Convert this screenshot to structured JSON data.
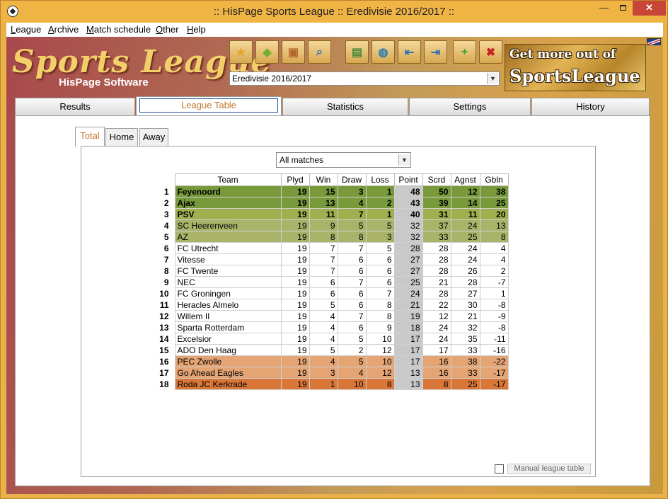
{
  "window": {
    "title": ":: HisPage Sports League :: Eredivisie 2016/2017 ::",
    "close_glyph": "✕",
    "minimize_glyph": "—"
  },
  "menu": [
    {
      "u": "L",
      "rest": "eague"
    },
    {
      "u": "A",
      "rest": "rchive"
    },
    {
      "u": "M",
      "rest": "atch schedule"
    },
    {
      "u": "O",
      "rest": "ther"
    },
    {
      "u": "H",
      "rest": "elp"
    }
  ],
  "logo": {
    "title": "Sports League",
    "subtitle": "HisPage Software"
  },
  "toolbar": {
    "icons": [
      "star-icon",
      "cube-icon",
      "box-icon",
      "magnifier-icon",
      "folder-globe-icon",
      "globe-icon",
      "import-icon",
      "export-icon",
      "add-icon",
      "delete-icon"
    ],
    "glyphs": [
      "★",
      "◆",
      "▣",
      "⌕",
      "▤",
      "◍",
      "⇤",
      "⇥",
      "+",
      "✖"
    ],
    "colors": [
      "#e3a52a",
      "#76b02f",
      "#b4652a",
      "#2a6fb4",
      "#4a8a3a",
      "#2a7ab4",
      "#2a6fb4",
      "#2a6fb4",
      "#3aa02a",
      "#c82020"
    ]
  },
  "league_select": {
    "value": "Eredivisie 2016/2017"
  },
  "ad": {
    "line1": "Get more out of",
    "line2": "SportsLeague"
  },
  "main_tabs": [
    "Results",
    "League Table",
    "Statistics",
    "Settings",
    "History"
  ],
  "sub_tabs": [
    "Total",
    "Home",
    "Away"
  ],
  "filter": {
    "value": "All matches"
  },
  "table": {
    "columns": [
      "Team",
      "Plyd",
      "Win",
      "Draw",
      "Loss",
      "Point",
      "Scrd",
      "Agnst",
      "Gbln"
    ],
    "rows": [
      {
        "pos": "1",
        "team": "Feyenoord",
        "plyd": "19",
        "win": "15",
        "draw": "3",
        "loss": "1",
        "point": "48",
        "scrd": "50",
        "agnst": "12",
        "gbln": "38",
        "zone": "z1"
      },
      {
        "pos": "2",
        "team": "Ajax",
        "plyd": "19",
        "win": "13",
        "draw": "4",
        "loss": "2",
        "point": "43",
        "scrd": "39",
        "agnst": "14",
        "gbln": "25",
        "zone": "z1"
      },
      {
        "pos": "3",
        "team": "PSV",
        "plyd": "19",
        "win": "11",
        "draw": "7",
        "loss": "1",
        "point": "40",
        "scrd": "31",
        "agnst": "11",
        "gbln": "20",
        "zone": "z2"
      },
      {
        "pos": "4",
        "team": "SC Heerenveen",
        "plyd": "19",
        "win": "9",
        "draw": "5",
        "loss": "5",
        "point": "32",
        "scrd": "37",
        "agnst": "24",
        "gbln": "13",
        "zone": "z3"
      },
      {
        "pos": "5",
        "team": "AZ",
        "plyd": "19",
        "win": "8",
        "draw": "8",
        "loss": "3",
        "point": "32",
        "scrd": "33",
        "agnst": "25",
        "gbln": "8",
        "zone": "z3"
      },
      {
        "pos": "6",
        "team": "FC Utrecht",
        "plyd": "19",
        "win": "7",
        "draw": "7",
        "loss": "5",
        "point": "28",
        "scrd": "28",
        "agnst": "24",
        "gbln": "4",
        "zone": "z4"
      },
      {
        "pos": "7",
        "team": "Vitesse",
        "plyd": "19",
        "win": "7",
        "draw": "6",
        "loss": "6",
        "point": "27",
        "scrd": "28",
        "agnst": "24",
        "gbln": "4",
        "zone": "z4"
      },
      {
        "pos": "8",
        "team": "FC Twente",
        "plyd": "19",
        "win": "7",
        "draw": "6",
        "loss": "6",
        "point": "27",
        "scrd": "28",
        "agnst": "26",
        "gbln": "2",
        "zone": "z4"
      },
      {
        "pos": "9",
        "team": "NEC",
        "plyd": "19",
        "win": "6",
        "draw": "7",
        "loss": "6",
        "point": "25",
        "scrd": "21",
        "agnst": "28",
        "gbln": "-7",
        "zone": "z4"
      },
      {
        "pos": "10",
        "team": "FC Groningen",
        "plyd": "19",
        "win": "6",
        "draw": "6",
        "loss": "7",
        "point": "24",
        "scrd": "28",
        "agnst": "27",
        "gbln": "1",
        "zone": "z4"
      },
      {
        "pos": "11",
        "team": "Heracles Almelo",
        "plyd": "19",
        "win": "5",
        "draw": "6",
        "loss": "8",
        "point": "21",
        "scrd": "22",
        "agnst": "30",
        "gbln": "-8",
        "zone": "z4"
      },
      {
        "pos": "12",
        "team": "Willem II",
        "plyd": "19",
        "win": "4",
        "draw": "7",
        "loss": "8",
        "point": "19",
        "scrd": "12",
        "agnst": "21",
        "gbln": "-9",
        "zone": "z4"
      },
      {
        "pos": "13",
        "team": "Sparta Rotterdam",
        "plyd": "19",
        "win": "4",
        "draw": "6",
        "loss": "9",
        "point": "18",
        "scrd": "24",
        "agnst": "32",
        "gbln": "-8",
        "zone": "z4"
      },
      {
        "pos": "14",
        "team": "Excelsior",
        "plyd": "19",
        "win": "4",
        "draw": "5",
        "loss": "10",
        "point": "17",
        "scrd": "24",
        "agnst": "35",
        "gbln": "-11",
        "zone": "z4"
      },
      {
        "pos": "15",
        "team": "ADO Den Haag",
        "plyd": "19",
        "win": "5",
        "draw": "2",
        "loss": "12",
        "point": "17",
        "scrd": "17",
        "agnst": "33",
        "gbln": "-16",
        "zone": "z4"
      },
      {
        "pos": "16",
        "team": "PEC Zwolle",
        "plyd": "19",
        "win": "4",
        "draw": "5",
        "loss": "10",
        "point": "17",
        "scrd": "16",
        "agnst": "38",
        "gbln": "-22",
        "zone": "z5"
      },
      {
        "pos": "17",
        "team": "Go Ahead Eagles",
        "plyd": "19",
        "win": "3",
        "draw": "4",
        "loss": "12",
        "point": "13",
        "scrd": "16",
        "agnst": "33",
        "gbln": "-17",
        "zone": "z5"
      },
      {
        "pos": "18",
        "team": "Roda JC Kerkrade",
        "plyd": "19",
        "win": "1",
        "draw": "10",
        "loss": "8",
        "point": "13",
        "scrd": "8",
        "agnst": "25",
        "gbln": "-17",
        "zone": "z6"
      }
    ]
  },
  "manual_checkbox": {
    "label": "Manual league table"
  }
}
